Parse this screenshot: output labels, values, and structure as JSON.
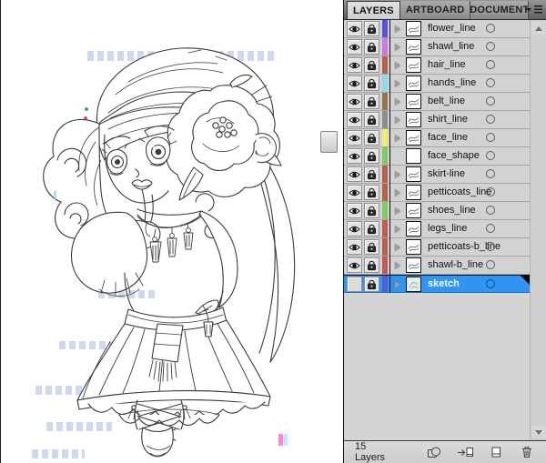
{
  "canvas": {
    "illustration": "chibi-girl-coloring-line-art"
  },
  "panel": {
    "tabs": [
      {
        "label": "LAYERS",
        "active": true
      },
      {
        "label": "ARTBOARD",
        "active": false
      },
      {
        "label": "DOCUMENT",
        "active": false
      }
    ],
    "menu_icon": "panel-menu-icon",
    "scrollbar": {
      "up_icon": "scroll-up-arrow-icon",
      "down_icon": "scroll-down-arrow-icon"
    },
    "status": {
      "layer_count": "15 Layers"
    },
    "footer_icons": [
      {
        "name": "make-clipping-mask-icon"
      },
      {
        "name": "create-new-sublayer-icon"
      },
      {
        "name": "create-new-layer-icon"
      },
      {
        "name": "delete-selection-icon"
      }
    ],
    "colors": {
      "selection_blue": "#2E95F4",
      "panel_gray": "#D2D2D2"
    }
  },
  "layers": [
    {
      "name": "flower_line",
      "color": "#5B50D8",
      "visible": true,
      "locked": true,
      "expandable": true,
      "selected": false
    },
    {
      "name": "shawl_line",
      "color": "#CB7BDA",
      "visible": true,
      "locked": true,
      "expandable": true,
      "selected": false
    },
    {
      "name": "hair_line",
      "color": "#B4604E",
      "visible": true,
      "locked": true,
      "expandable": true,
      "selected": false
    },
    {
      "name": "hands_line",
      "color": "#8FD9EA",
      "visible": true,
      "locked": true,
      "expandable": true,
      "selected": false
    },
    {
      "name": "belt_line",
      "color": "#9A7350",
      "visible": true,
      "locked": true,
      "expandable": true,
      "selected": false
    },
    {
      "name": "shirt_line",
      "color": "#8C8C8C",
      "visible": true,
      "locked": true,
      "expandable": true,
      "selected": false
    },
    {
      "name": "face_line",
      "color": "#EDED6E",
      "visible": true,
      "locked": true,
      "expandable": true,
      "selected": false
    },
    {
      "name": "face_shape",
      "color": "#7ECB67",
      "visible": true,
      "locked": true,
      "expandable": false,
      "selected": false
    },
    {
      "name": "skirt-line",
      "color": "#B4604E",
      "visible": true,
      "locked": true,
      "expandable": true,
      "selected": false
    },
    {
      "name": "petticoats_line",
      "color": "#B4604E",
      "visible": true,
      "locked": true,
      "expandable": true,
      "selected": false
    },
    {
      "name": "shoes_line",
      "color": "#7ECB67",
      "visible": true,
      "locked": true,
      "expandable": true,
      "selected": false
    },
    {
      "name": "legs_line",
      "color": "#C45B52",
      "visible": true,
      "locked": true,
      "expandable": true,
      "selected": false
    },
    {
      "name": "petticoats-b_line",
      "color": "#B4604E",
      "visible": true,
      "locked": true,
      "expandable": true,
      "selected": false
    },
    {
      "name": "shawl-b_line",
      "color": "#C45B52",
      "visible": true,
      "locked": true,
      "expandable": true,
      "selected": false
    },
    {
      "name": "sketch",
      "color": "#4E62D8",
      "visible": false,
      "locked": true,
      "expandable": true,
      "selected": true,
      "thumb_tint": "#E2EEE5"
    }
  ]
}
